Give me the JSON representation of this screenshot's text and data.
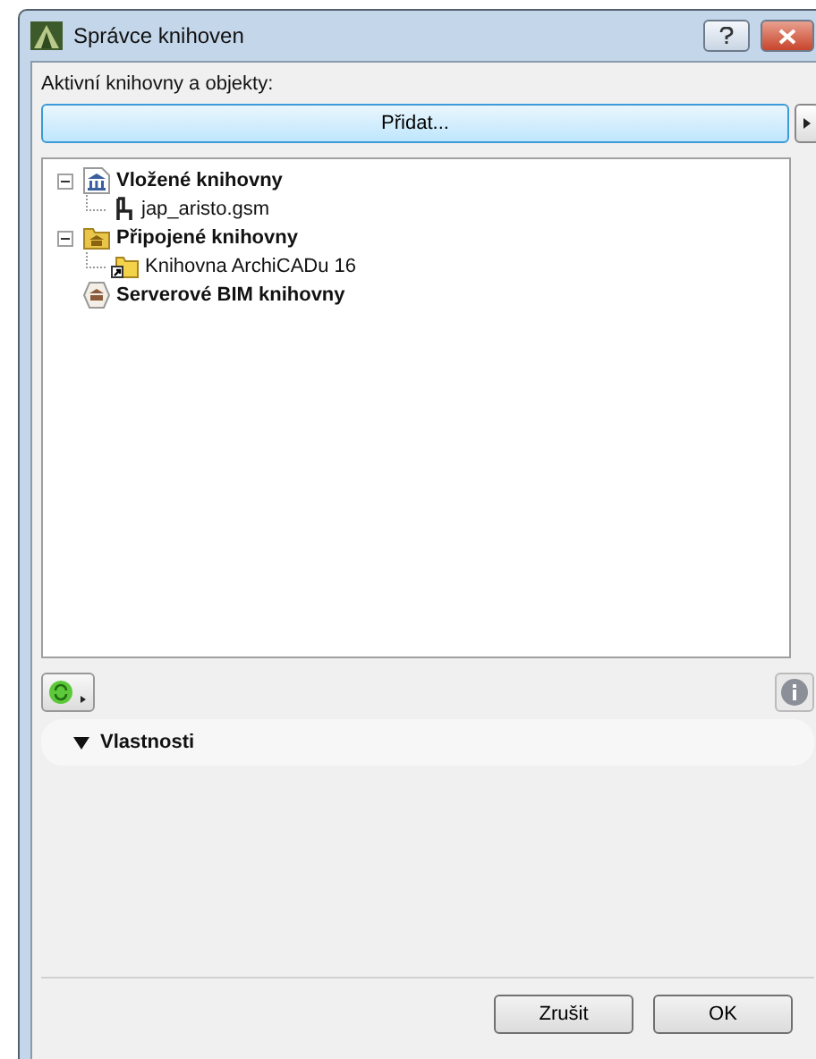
{
  "window": {
    "title": "Správce knihoven"
  },
  "libraries_label": "Aktivní knihovny a objekty:",
  "add_button": "Přidat...",
  "tree": [
    {
      "label": "Vložené knihovny",
      "kind": "embedded",
      "expanded": true,
      "children": [
        {
          "label": "jap_aristo.gsm",
          "kind": "object"
        }
      ]
    },
    {
      "label": "Připojené knihovny",
      "kind": "linked",
      "expanded": true,
      "children": [
        {
          "label": "Knihovna ArchiCADu 16",
          "kind": "folder"
        }
      ]
    },
    {
      "label": "Serverové BIM knihovny",
      "kind": "server"
    }
  ],
  "properties": {
    "title": "Vlastnosti",
    "expanded": true
  },
  "buttons": [
    "Zrušit",
    "OK"
  ]
}
